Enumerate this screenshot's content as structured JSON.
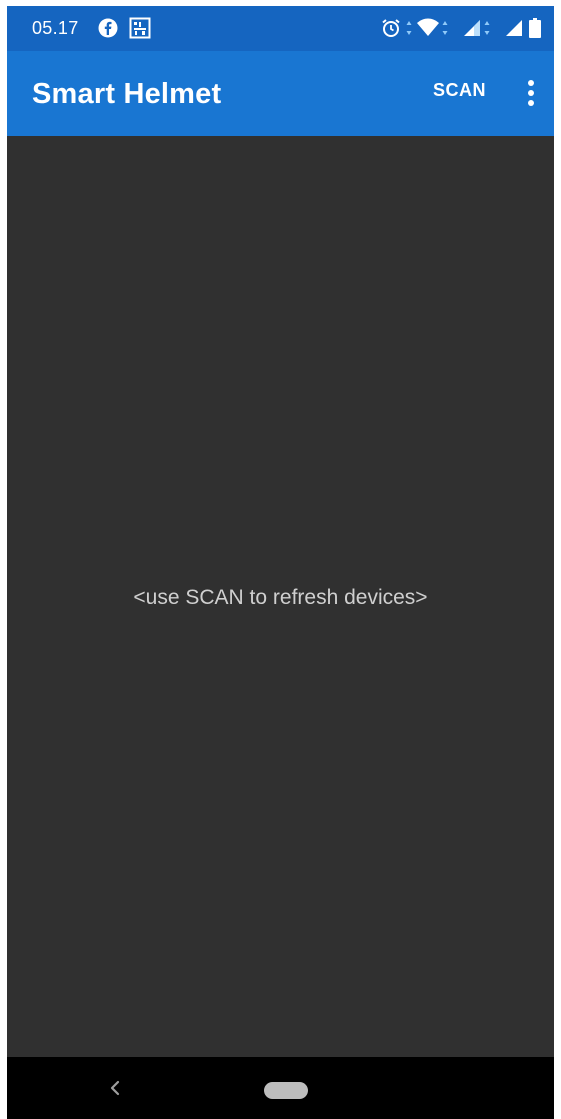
{
  "status_bar": {
    "time": "05.17",
    "icons": [
      "facebook-icon",
      "notification-app-icon",
      "alarm-icon",
      "wifi-icon",
      "signal-icon",
      "signal-icon",
      "battery-icon"
    ]
  },
  "app_bar": {
    "title": "Smart Helmet",
    "scan_label": "SCAN",
    "menu_icon": "more-vert-icon"
  },
  "main": {
    "empty_message": "<use SCAN to refresh devices>"
  },
  "nav_bar": {
    "back_icon": "back-icon",
    "home_icon": "home-pill-icon"
  },
  "colors": {
    "status_bar": "#1565c0",
    "app_bar": "#1976d2",
    "background": "#303030",
    "nav_bar": "#000000"
  }
}
